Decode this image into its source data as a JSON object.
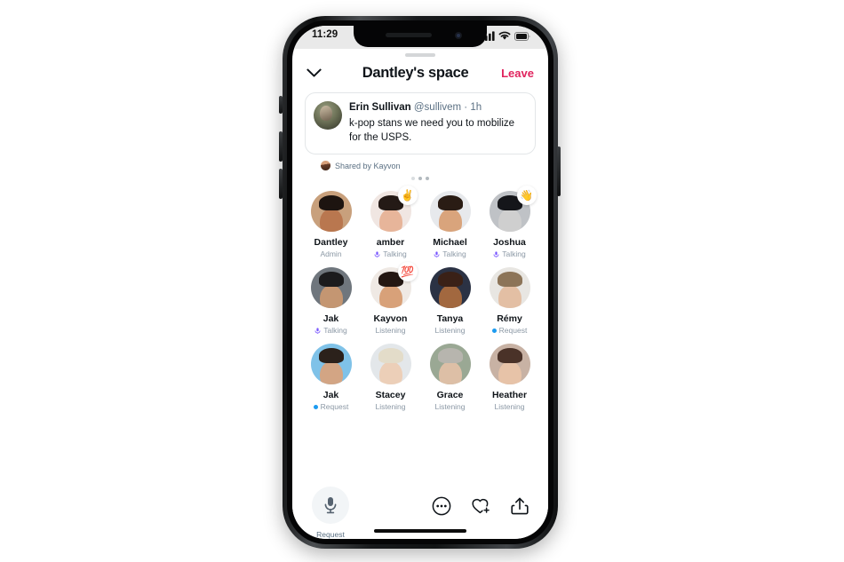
{
  "status_bar": {
    "time": "11:29",
    "signal_icon": "cellular-bars-icon",
    "wifi_icon": "wifi-icon",
    "battery_icon": "battery-icon"
  },
  "header": {
    "collapse_icon": "chevron-down-icon",
    "title": "Dantley's space",
    "leave_label": "Leave",
    "leave_color": "#e0245e"
  },
  "shared_tweet": {
    "author_name": "Erin Sullivan",
    "author_handle": "@sullivem",
    "separator": "·",
    "timestamp": "1h",
    "text": "k-pop stans we need you to mobilize for the USPS.",
    "avatar_icon": "tweet-author-avatar",
    "shared_by_label": "Shared by Kayvon",
    "shared_by_avatar_icon": "sharer-avatar",
    "pagination_dots": 3,
    "active_dot_index": 0
  },
  "participants": [
    {
      "name": "Dantley",
      "status": "Admin",
      "status_type": "admin",
      "emoji": "",
      "skin": "#b9774f",
      "hair": "#1d1410",
      "bg": "#c8a07c"
    },
    {
      "name": "amber",
      "status": "Talking",
      "status_type": "talking",
      "emoji": "✌️",
      "skin": "#e7b59a",
      "hair": "#241a16",
      "bg": "#f0e6e2"
    },
    {
      "name": "Michael",
      "status": "Talking",
      "status_type": "talking",
      "emoji": "",
      "skin": "#d9a47c",
      "hair": "#2a1c14",
      "bg": "#e7e9ec"
    },
    {
      "name": "Joshua",
      "status": "Talking",
      "status_type": "talking",
      "emoji": "👋",
      "skin": "#cfcfcf",
      "hair": "#15161a",
      "bg": "#bfc2c6"
    },
    {
      "name": "Jak",
      "status": "Talking",
      "status_type": "talking",
      "emoji": "",
      "skin": "#c49672",
      "hair": "#1b1b1d",
      "bg": "#6f767d"
    },
    {
      "name": "Kayvon",
      "status": "Listening",
      "status_type": "listening",
      "emoji": "💯",
      "skin": "#d8a179",
      "hair": "#241712",
      "bg": "#efe9e4"
    },
    {
      "name": "Tanya",
      "status": "Listening",
      "status_type": "listening",
      "emoji": "",
      "skin": "#a2683f",
      "hair": "#3a2117",
      "bg": "#2b3244"
    },
    {
      "name": "Rémy",
      "status": "Request",
      "status_type": "request",
      "emoji": "",
      "skin": "#e3bfa4",
      "hair": "#8c7458",
      "bg": "#e8e6e2"
    },
    {
      "name": "Jak",
      "status": "Request",
      "status_type": "request",
      "emoji": "",
      "skin": "#d3a584",
      "hair": "#2b211b",
      "bg": "#7fc2e8"
    },
    {
      "name": "Stacey",
      "status": "Listening",
      "status_type": "listening",
      "emoji": "",
      "skin": "#eccfb8",
      "hair": "#e3dcc9",
      "bg": "#e3e7ea"
    },
    {
      "name": "Grace",
      "status": "Listening",
      "status_type": "listening",
      "emoji": "",
      "skin": "#ddbfa6",
      "hair": "#b7b5ae",
      "bg": "#9aa894"
    },
    {
      "name": "Heather",
      "status": "Listening",
      "status_type": "listening",
      "emoji": "",
      "skin": "#e7c3a8",
      "hair": "#4a3228",
      "bg": "#c8b2a4"
    }
  ],
  "status_colors": {
    "talking": "#7856ff",
    "request": "#1d9bf0",
    "text": "#8b98a5"
  },
  "bottom_bar": {
    "mic_icon": "microphone-icon",
    "mic_label": "Request",
    "more_icon": "more-options-icon",
    "heart_plus_icon": "heart-plus-icon",
    "share_icon": "share-upload-icon",
    "home_indicator_icon": "home-indicator"
  }
}
